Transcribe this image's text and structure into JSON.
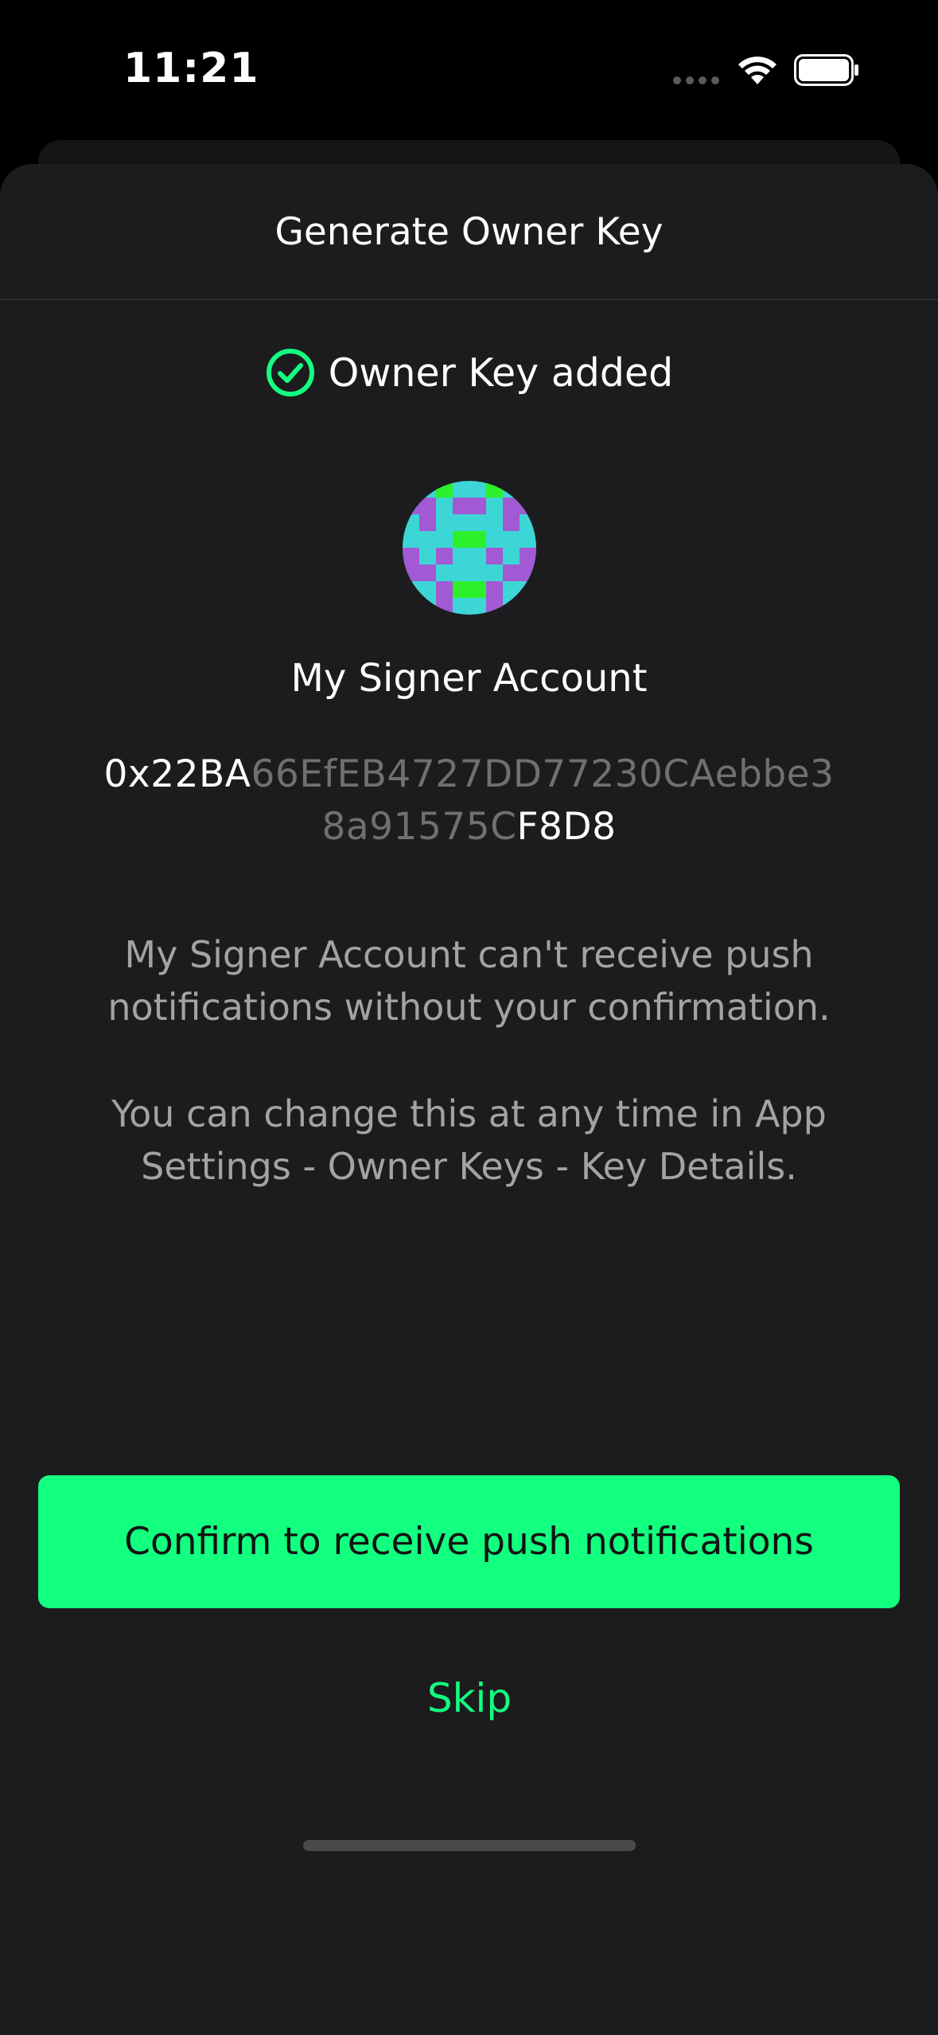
{
  "status_bar": {
    "time": "11:21"
  },
  "sheet": {
    "title": "Generate Owner Key"
  },
  "status": {
    "added_text": "Owner Key added"
  },
  "account": {
    "name": "My Signer Account",
    "address_prefix": "0x22BA",
    "address_middle": "66EfEB4727DD77230CAebbe38a91575C",
    "address_suffix": "F8D8"
  },
  "info": {
    "paragraph_1": "My Signer Account can't receive push notifications without your confirmation.",
    "paragraph_2": "You can change this at any time in App Settings - Owner Keys - Key Details."
  },
  "actions": {
    "confirm_label": "Confirm to receive push notifications",
    "skip_label": "Skip"
  },
  "colors": {
    "accent": "#12ff80",
    "background": "#1c1c1e",
    "muted_text": "#a3a3a6"
  },
  "icons": {
    "check": "check-circle-icon",
    "wifi": "wifi-icon",
    "battery": "battery-icon"
  }
}
